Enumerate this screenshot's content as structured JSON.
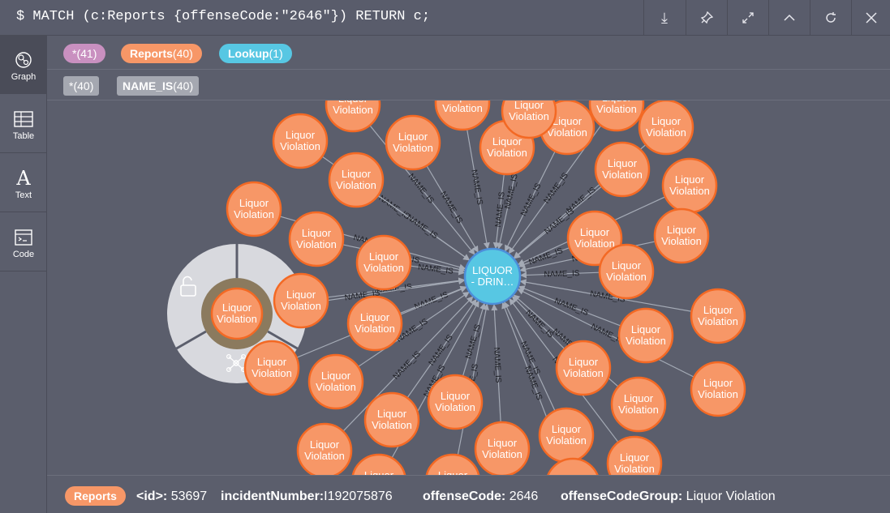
{
  "header": {
    "query": "$ MATCH (c:Reports {offenseCode:\"2646\"}) RETURN c;",
    "buttons": [
      {
        "name": "download-icon",
        "glyph": "⤓"
      },
      {
        "name": "pin-icon",
        "glyph": "📌"
      },
      {
        "name": "expand-icon",
        "glyph": "⤢"
      },
      {
        "name": "collapse-icon",
        "glyph": "︿"
      },
      {
        "name": "rerun-icon",
        "glyph": "⟲"
      },
      {
        "name": "close-icon",
        "glyph": "✕"
      }
    ]
  },
  "sidebar": {
    "items": [
      {
        "label": "Graph",
        "icon": "graph-icon"
      },
      {
        "label": "Table",
        "icon": "table-icon"
      },
      {
        "label": "Text",
        "icon": "text-icon"
      },
      {
        "label": "Code",
        "icon": "code-icon"
      }
    ]
  },
  "legend": {
    "labels": [
      {
        "name": "*",
        "count": "(41)",
        "color": "#c990c0"
      },
      {
        "name": "Reports",
        "count": "(40)",
        "color": "#f79767"
      },
      {
        "name": "Lookup",
        "count": "(1)",
        "color": "#57c7e3"
      }
    ],
    "relationships": [
      {
        "name": "*",
        "count": "(40)"
      },
      {
        "name": "NAME_IS",
        "count": "(40)"
      }
    ]
  },
  "graph": {
    "center_node": {
      "label": "LIQUOR\n- DRIN…",
      "color": "#57c7e3"
    },
    "node_label": "Liquor\nViolation",
    "node_color": "#f79767",
    "edge_label": "NAME_IS",
    "selected_node_label": "Liquor\nViolation"
  },
  "footer": {
    "label": "Reports",
    "props": [
      {
        "key": "<id>:",
        "value": "53697"
      },
      {
        "key": "incidentNumber:",
        "value": "I192075876"
      },
      {
        "key": "offenseCode:",
        "value": "2646"
      },
      {
        "key": "offenseCodeGroup:",
        "value": "Liquor Violation"
      }
    ]
  }
}
